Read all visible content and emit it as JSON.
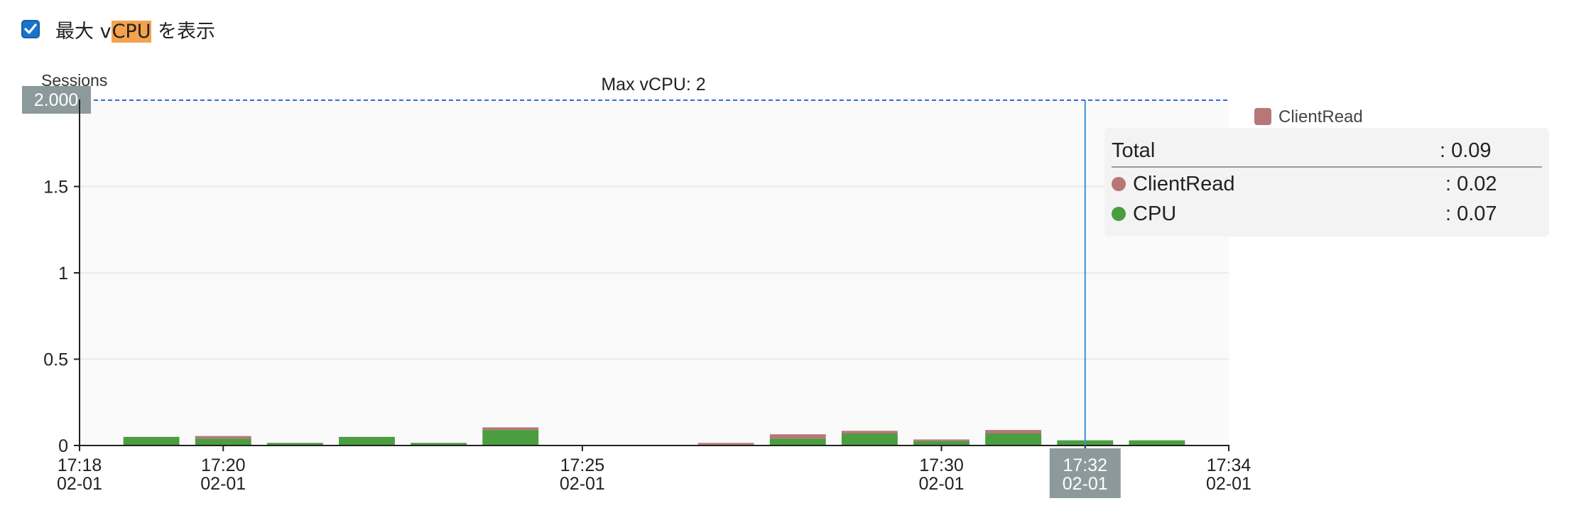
{
  "toggle": {
    "checked": true,
    "label_prefix": "最大 v",
    "label_highlight": "CPU",
    "label_suffix": " を表示"
  },
  "chart_data": {
    "type": "bar",
    "stacked": true,
    "ylabel": "Sessions",
    "ylim": [
      0,
      2
    ],
    "yticks": [
      "0",
      "0.5",
      "1",
      "1.5"
    ],
    "max_line": {
      "value": 2,
      "label": "Max vCPU: 2",
      "tag": "2.000"
    },
    "x_start": "17:18",
    "x_end": "17:34",
    "x_ticks": [
      {
        "time": "17:18",
        "date": "02-01"
      },
      {
        "time": "17:20",
        "date": "02-01"
      },
      {
        "time": "17:25",
        "date": "02-01"
      },
      {
        "time": "17:30",
        "date": "02-01"
      },
      {
        "time": "17:32",
        "date": "02-01",
        "highlight": true
      },
      {
        "time": "17:34",
        "date": "02-01"
      }
    ],
    "categories": [
      "17:19",
      "17:20",
      "17:21",
      "17:22",
      "17:23",
      "17:24",
      "17:25",
      "17:26",
      "17:27",
      "17:28",
      "17:29",
      "17:30",
      "17:31",
      "17:32",
      "17:33"
    ],
    "series": [
      {
        "name": "CPU",
        "color": "#4a9e3f",
        "values": [
          0.05,
          0.04,
          0.015,
          0.05,
          0.015,
          0.09,
          0,
          0,
          0.005,
          0.04,
          0.07,
          0.025,
          0.07,
          0.03,
          0.03
        ]
      },
      {
        "name": "ClientRead",
        "color": "#b77777",
        "values": [
          0,
          0.015,
          0,
          0,
          0,
          0.015,
          0,
          0,
          0.01,
          0.025,
          0.015,
          0.01,
          0.02,
          0,
          0
        ]
      }
    ],
    "cursor": "17:32",
    "legend": {
      "position": "right",
      "items": [
        {
          "name": "ClientRead",
          "color": "#b77777"
        }
      ]
    }
  },
  "tooltip": {
    "total_label": "Total",
    "total_value": ": 0.09",
    "rows": [
      {
        "name": "ClientRead",
        "value": ": 0.02",
        "color": "#b77777"
      },
      {
        "name": "CPU",
        "value": ": 0.07",
        "color": "#4a9e3f"
      }
    ]
  }
}
